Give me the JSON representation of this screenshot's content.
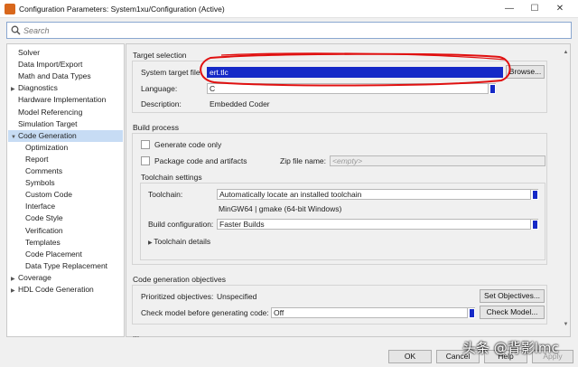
{
  "window": {
    "title": "Configuration Parameters: System1xu/Configuration (Active)",
    "controls": {
      "minimize": "—",
      "maximize": "☐",
      "close": "✕"
    }
  },
  "search": {
    "placeholder": "Search",
    "icon": "search-icon"
  },
  "tree": {
    "items": [
      {
        "label": "Solver",
        "indent": 0,
        "arrow": ""
      },
      {
        "label": "Data Import/Export",
        "indent": 0,
        "arrow": ""
      },
      {
        "label": "Math and Data Types",
        "indent": 0,
        "arrow": ""
      },
      {
        "label": "Diagnostics",
        "indent": 0,
        "arrow": "▶"
      },
      {
        "label": "Hardware Implementation",
        "indent": 0,
        "arrow": ""
      },
      {
        "label": "Model Referencing",
        "indent": 0,
        "arrow": ""
      },
      {
        "label": "Simulation Target",
        "indent": 0,
        "arrow": ""
      },
      {
        "label": "Code Generation",
        "indent": 0,
        "arrow": "▼",
        "selected": true
      },
      {
        "label": "Optimization",
        "indent": 1,
        "arrow": ""
      },
      {
        "label": "Report",
        "indent": 1,
        "arrow": ""
      },
      {
        "label": "Comments",
        "indent": 1,
        "arrow": ""
      },
      {
        "label": "Symbols",
        "indent": 1,
        "arrow": ""
      },
      {
        "label": "Custom Code",
        "indent": 1,
        "arrow": ""
      },
      {
        "label": "Interface",
        "indent": 1,
        "arrow": ""
      },
      {
        "label": "Code Style",
        "indent": 1,
        "arrow": ""
      },
      {
        "label": "Verification",
        "indent": 1,
        "arrow": ""
      },
      {
        "label": "Templates",
        "indent": 1,
        "arrow": ""
      },
      {
        "label": "Code Placement",
        "indent": 1,
        "arrow": ""
      },
      {
        "label": "Data Type Replacement",
        "indent": 1,
        "arrow": ""
      },
      {
        "label": "Coverage",
        "indent": 0,
        "arrow": "▶"
      },
      {
        "label": "HDL Code Generation",
        "indent": 0,
        "arrow": "▶"
      }
    ]
  },
  "target": {
    "section": "Target selection",
    "stf_label": "System target file:",
    "stf_value": "ert.tlc",
    "browse": "Browse...",
    "lang_label": "Language:",
    "lang_value": "C",
    "desc_label": "Description:",
    "desc_value": "Embedded Coder"
  },
  "build": {
    "section": "Build process",
    "gen_only": "Generate code only",
    "package": "Package code and artifacts",
    "zip_label": "Zip file name:",
    "zip_placeholder": "<empty>",
    "toolchain_settings": "Toolchain settings",
    "toolchain_label": "Toolchain:",
    "toolchain_value": "Automatically locate an installed toolchain",
    "toolchain_info": "MinGW64 | gmake (64-bit Windows)",
    "buildconf_label": "Build configuration:",
    "buildconf_value": "Faster Builds",
    "details": "Toolchain details"
  },
  "objectives": {
    "section": "Code generation objectives",
    "prio_label": "Prioritized objectives:",
    "prio_value": "Unspecified",
    "set_btn": "Set Objectives...",
    "check_label": "Check model before generating code:",
    "check_value": "Off",
    "check_btn": "Check Model..."
  },
  "more": "...",
  "bottom": {
    "ok": "OK",
    "cancel": "Cancel",
    "help": "Help",
    "apply": "Apply"
  },
  "watermark": "头条 @背影lmc",
  "colors": {
    "highlight": "#1529c7",
    "selected_row": "#c7dcf4",
    "annotation": "#e01010"
  }
}
